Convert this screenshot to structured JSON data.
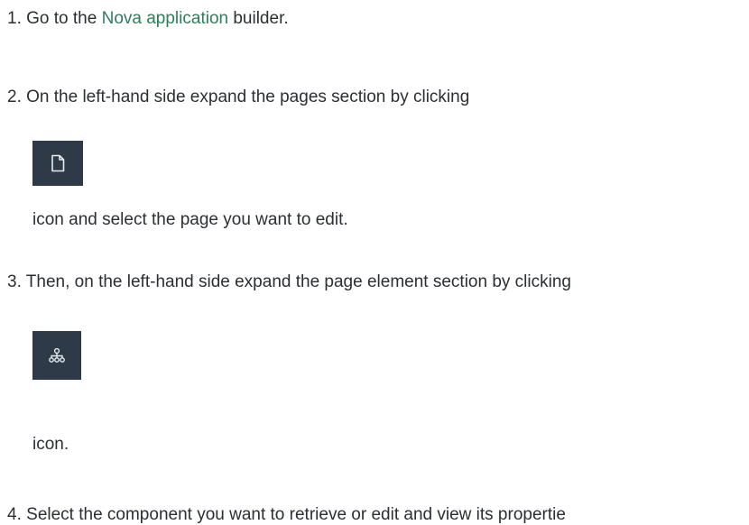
{
  "steps": [
    {
      "number": "1.",
      "before_link": "Go to the ",
      "link": "Nova application",
      "after_link": " builder."
    },
    {
      "number": "2.",
      "text": "On the left-hand side expand the pages section by clicking",
      "icon": "page-icon",
      "after_icon": "icon and select the page you want to edit."
    },
    {
      "number": "3.",
      "text": "Then, on the left-hand side expand the page element section by clicking",
      "icon": "sitemap-icon",
      "after_icon": "icon."
    },
    {
      "number": "4.",
      "text": "Select the component you want to retrieve or edit and view its propertie"
    }
  ],
  "colors": {
    "link": "#2f7d5a",
    "icon_bg": "#2e3a48",
    "text": "#2b2f33"
  }
}
